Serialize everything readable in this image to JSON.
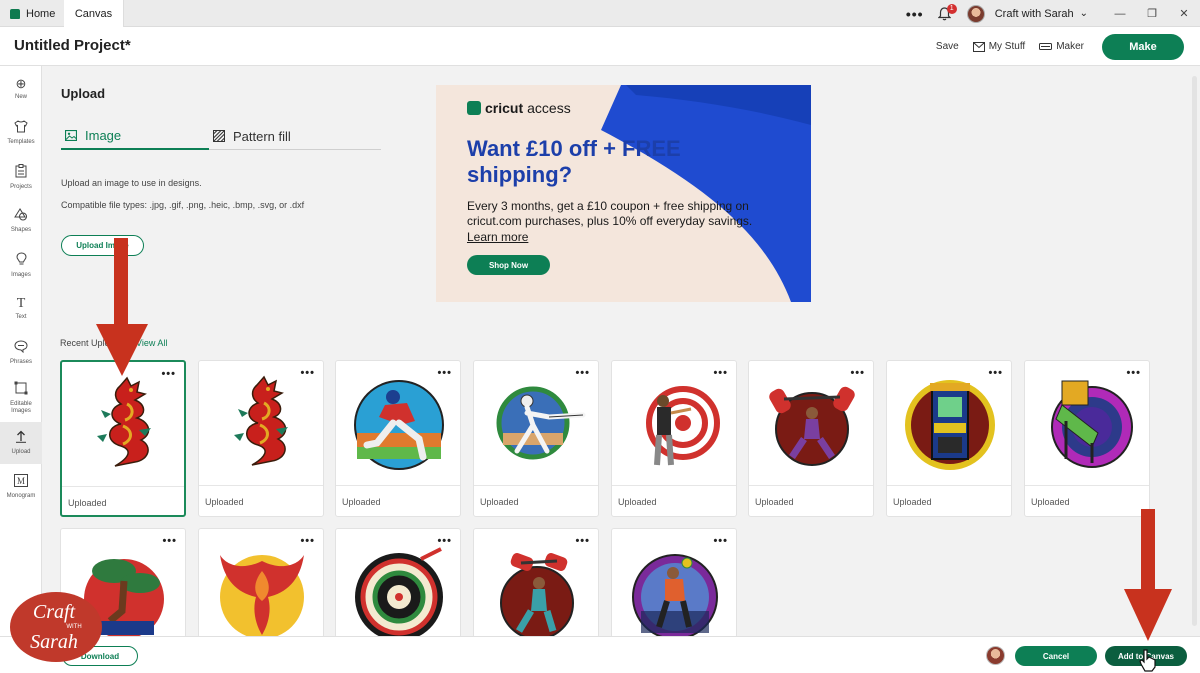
{
  "tabs": {
    "home": "Home",
    "canvas": "Canvas"
  },
  "topbar": {
    "notification_count": "1",
    "user_name": "Craft with Sarah"
  },
  "header": {
    "project_title": "Untitled Project*",
    "save": "Save",
    "my_stuff": "My Stuff",
    "maker": "Maker",
    "make": "Make"
  },
  "sidebar": {
    "items": [
      {
        "label": "New",
        "icon": "plus-circle-icon"
      },
      {
        "label": "Templates",
        "icon": "shirt-icon"
      },
      {
        "label": "Projects",
        "icon": "clipboard-icon"
      },
      {
        "label": "Shapes",
        "icon": "shapes-icon"
      },
      {
        "label": "Images",
        "icon": "lightbulb-icon"
      },
      {
        "label": "Text",
        "icon": "text-icon"
      },
      {
        "label": "Phrases",
        "icon": "speech-bubble-icon"
      },
      {
        "label": "Editable Images",
        "icon": "editable-image-icon"
      },
      {
        "label": "Upload",
        "icon": "upload-icon"
      },
      {
        "label": "Monogram",
        "icon": "monogram-icon"
      }
    ]
  },
  "upload_panel": {
    "heading": "Upload",
    "tab_image": "Image",
    "tab_pattern": "Pattern fill",
    "description": "Upload an image to use in designs.",
    "file_types": "Compatible file types: .jpg, .gif, .png, .heic, .bmp, .svg, or .dxf",
    "upload_button": "Upload Image"
  },
  "ad": {
    "brand_a": "cricut",
    "brand_b": "access",
    "title": "Want £10 off + FREE shipping?",
    "body": "Every 3 months, get a £10 coupon + free shipping on cricut.com purchases, plus 10% off everyday savings.",
    "learn_more": "Learn more",
    "shop_now": "Shop Now"
  },
  "recent": {
    "label": "Recent Uploads",
    "view_all": "View All",
    "items": [
      {
        "label": "Uploaded",
        "subject": "dragon"
      },
      {
        "label": "Uploaded",
        "subject": "dragon"
      },
      {
        "label": "Uploaded",
        "subject": "baseball-player"
      },
      {
        "label": "Uploaded",
        "subject": "fencer"
      },
      {
        "label": "Uploaded",
        "subject": "archer"
      },
      {
        "label": "Uploaded",
        "subject": "weightlifter"
      },
      {
        "label": "Uploaded",
        "subject": "arcade-machine"
      },
      {
        "label": "Uploaded",
        "subject": "pinball-machine"
      },
      {
        "label": "",
        "subject": "bonsai-tree"
      },
      {
        "label": "",
        "subject": "phoenix"
      },
      {
        "label": "",
        "subject": "dartboard"
      },
      {
        "label": "",
        "subject": "weightlifter"
      },
      {
        "label": "",
        "subject": "handball-player"
      }
    ]
  },
  "bottom": {
    "download": "Download",
    "cancel": "Cancel",
    "add_to_canvas": "Add to Canvas"
  },
  "brand_watermark": {
    "line1": "Craft",
    "line2": "WITH",
    "line3": "Sarah"
  },
  "colors": {
    "primary": "#0d7f55",
    "ad_blue": "#1c3faa",
    "arrow_red": "#c8321e"
  }
}
